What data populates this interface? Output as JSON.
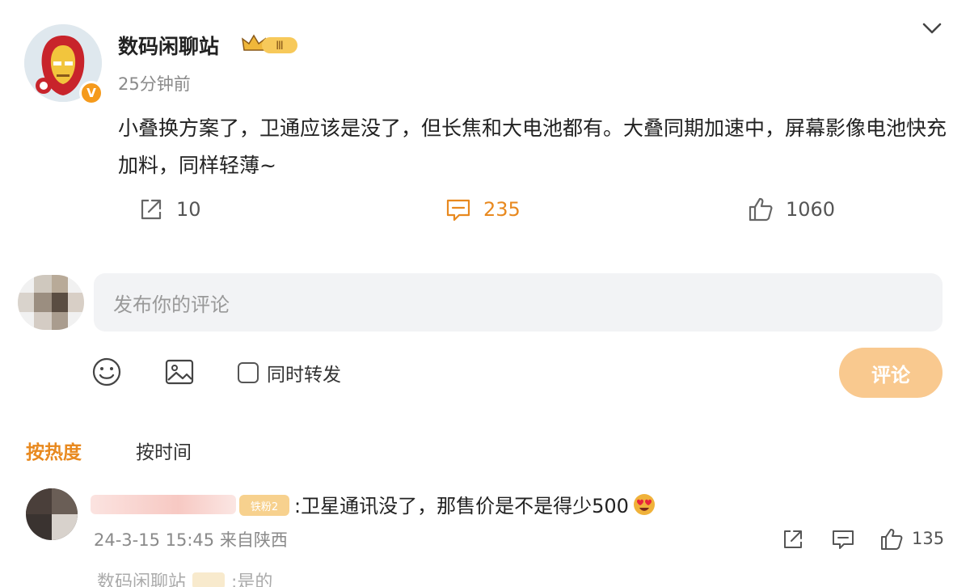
{
  "post": {
    "author": "数码闲聊站",
    "level_badge": "Ⅲ",
    "verified_badge": "V",
    "time_ago": "25分钟前",
    "content": "小叠换方案了，卫通应该是没了，但长焦和大电池都有。大叠同期加速中，屏幕影像电池快充加料，同样轻薄~",
    "actions": {
      "share_count": "10",
      "comment_count": "235",
      "like_count": "1060"
    }
  },
  "composer": {
    "placeholder": "发布你的评论",
    "repost_label": "同时转发",
    "submit_label": "评论"
  },
  "sort": {
    "hot_label": "按热度",
    "time_label": "按时间"
  },
  "reply": {
    "fan_badge": "铁粉2",
    "text": ":卫星通讯没了，那售价是不是得少500",
    "meta": "24-3-15 15:45 来自陕西",
    "like_count": "135"
  },
  "sub_reply": {
    "author": "数码闲聊站",
    "text": ":是的"
  },
  "colors": {
    "accent": "#e8891f",
    "submit_bg": "#f9c98f",
    "input_bg": "#f2f3f5",
    "verified": "#f59a1c"
  },
  "icons": [
    "chevron-down-icon",
    "share-icon",
    "comment-icon",
    "like-icon",
    "emoji-icon",
    "image-icon"
  ]
}
